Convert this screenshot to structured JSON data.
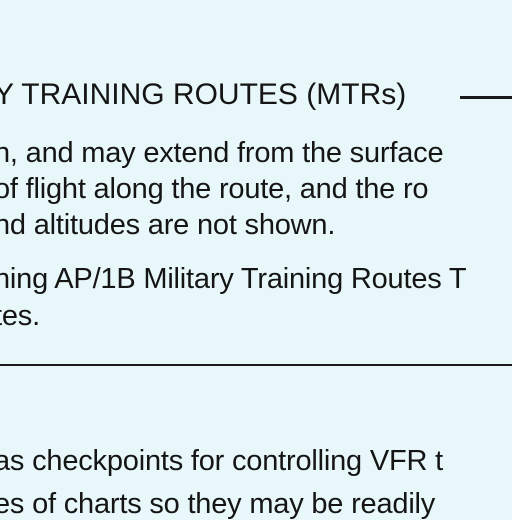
{
  "document": {
    "heading": "Y TRAINING ROUTES (MTRs)",
    "lines": [
      "n, and may extend from the surface",
      " of flight along the route, and the ro",
      "nd altitudes are not shown.",
      "ning AP/1B Military Training Routes T",
      "tes.",
      " as checkpoints for controlling VFR t",
      "es of charts so they may be readily"
    ]
  }
}
